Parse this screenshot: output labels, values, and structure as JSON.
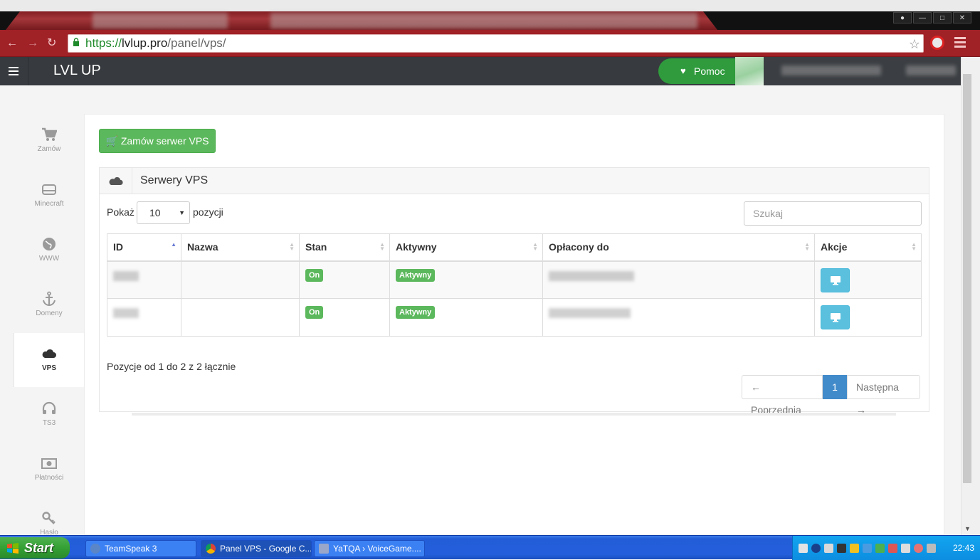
{
  "browser": {
    "tab_title": "Panel VPS",
    "url_scheme": "https://",
    "url_host": "lvlup.pro",
    "url_path": "/panel/vps/"
  },
  "header": {
    "brand": "LVL UP",
    "help_label": "Pomoc"
  },
  "sidebar": {
    "items": [
      {
        "label": "Zamów",
        "icon": "cart-icon"
      },
      {
        "label": "Minecraft",
        "icon": "hdd-icon"
      },
      {
        "label": "WWW",
        "icon": "globe-icon"
      },
      {
        "label": "Domeny",
        "icon": "anchor-icon"
      },
      {
        "label": "VPS",
        "icon": "cloud-icon",
        "active": true
      },
      {
        "label": "TS3",
        "icon": "headphones-icon"
      },
      {
        "label": "Płatności",
        "icon": "money-icon"
      },
      {
        "label": "Hasło",
        "icon": "key-icon"
      }
    ]
  },
  "main": {
    "order_button": "Zamów serwer VPS",
    "box_title": "Serwery VPS",
    "length_prefix": "Pokaż",
    "length_value": "10",
    "length_suffix": "pozycji",
    "search_placeholder": "Szukaj",
    "columns": [
      "ID",
      "Nazwa",
      "Stan",
      "Aktywny",
      "Opłacony do",
      "Akcje"
    ],
    "rows": [
      {
        "state": "On",
        "active": "Aktywny"
      },
      {
        "state": "On",
        "active": "Aktywny"
      }
    ],
    "info": "Pozycje od 1 do 2 z 2 łącznie",
    "pager": {
      "prev": "← Poprzednia",
      "current": "1",
      "next": "Następna →"
    }
  },
  "taskbar": {
    "start": "Start",
    "tasks": [
      "TeamSpeak 3",
      "Panel VPS - Google C...",
      "YaTQA › VoiceGame...."
    ],
    "clock": "22:43"
  },
  "colors": {
    "chrome_red": "#a02126",
    "header_dark": "#373a3e",
    "success_green": "#5cb85c",
    "info_blue": "#5bc0de",
    "primary_blue": "#428bca"
  }
}
